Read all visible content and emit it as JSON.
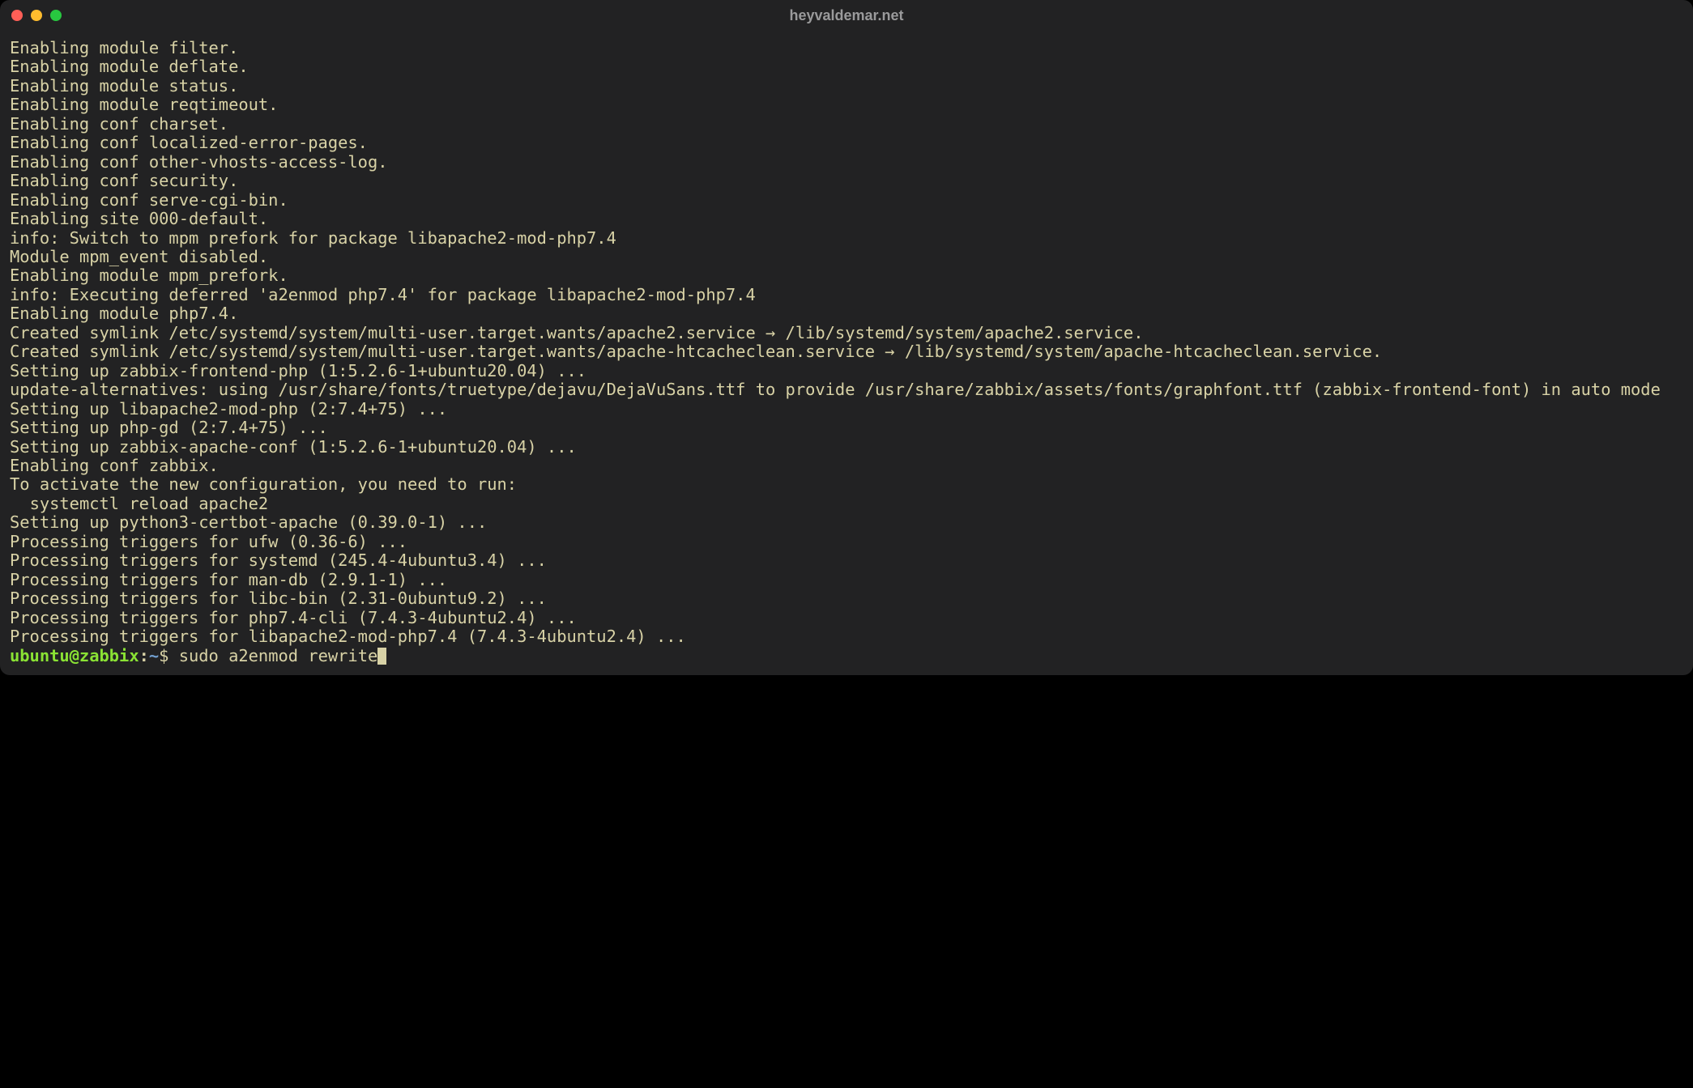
{
  "window": {
    "title": "heyvaldemar.net"
  },
  "output": [
    "Enabling module filter.",
    "Enabling module deflate.",
    "Enabling module status.",
    "Enabling module reqtimeout.",
    "Enabling conf charset.",
    "Enabling conf localized-error-pages.",
    "Enabling conf other-vhosts-access-log.",
    "Enabling conf security.",
    "Enabling conf serve-cgi-bin.",
    "Enabling site 000-default.",
    "info: Switch to mpm prefork for package libapache2-mod-php7.4",
    "Module mpm_event disabled.",
    "Enabling module mpm_prefork.",
    "info: Executing deferred 'a2enmod php7.4' for package libapache2-mod-php7.4",
    "Enabling module php7.4.",
    "Created symlink /etc/systemd/system/multi-user.target.wants/apache2.service → /lib/systemd/system/apache2.service.",
    "Created symlink /etc/systemd/system/multi-user.target.wants/apache-htcacheclean.service → /lib/systemd/system/apache-htcacheclean.service.",
    "Setting up zabbix-frontend-php (1:5.2.6-1+ubuntu20.04) ...",
    "update-alternatives: using /usr/share/fonts/truetype/dejavu/DejaVuSans.ttf to provide /usr/share/zabbix/assets/fonts/graphfont.ttf (zabbix-frontend-font) in auto mode",
    "Setting up libapache2-mod-php (2:7.4+75) ...",
    "Setting up php-gd (2:7.4+75) ...",
    "Setting up zabbix-apache-conf (1:5.2.6-1+ubuntu20.04) ...",
    "Enabling conf zabbix.",
    "To activate the new configuration, you need to run:",
    "  systemctl reload apache2",
    "Setting up python3-certbot-apache (0.39.0-1) ...",
    "Processing triggers for ufw (0.36-6) ...",
    "Processing triggers for systemd (245.4-4ubuntu3.4) ...",
    "Processing triggers for man-db (2.9.1-1) ...",
    "Processing triggers for libc-bin (2.31-0ubuntu9.2) ...",
    "Processing triggers for php7.4-cli (7.4.3-4ubuntu2.4) ...",
    "Processing triggers for libapache2-mod-php7.4 (7.4.3-4ubuntu2.4) ..."
  ],
  "prompt": {
    "user_host": "ubuntu@zabbix",
    "colon": ":",
    "path": "~",
    "symbol": "$ ",
    "command": "sudo a2enmod rewrite"
  }
}
